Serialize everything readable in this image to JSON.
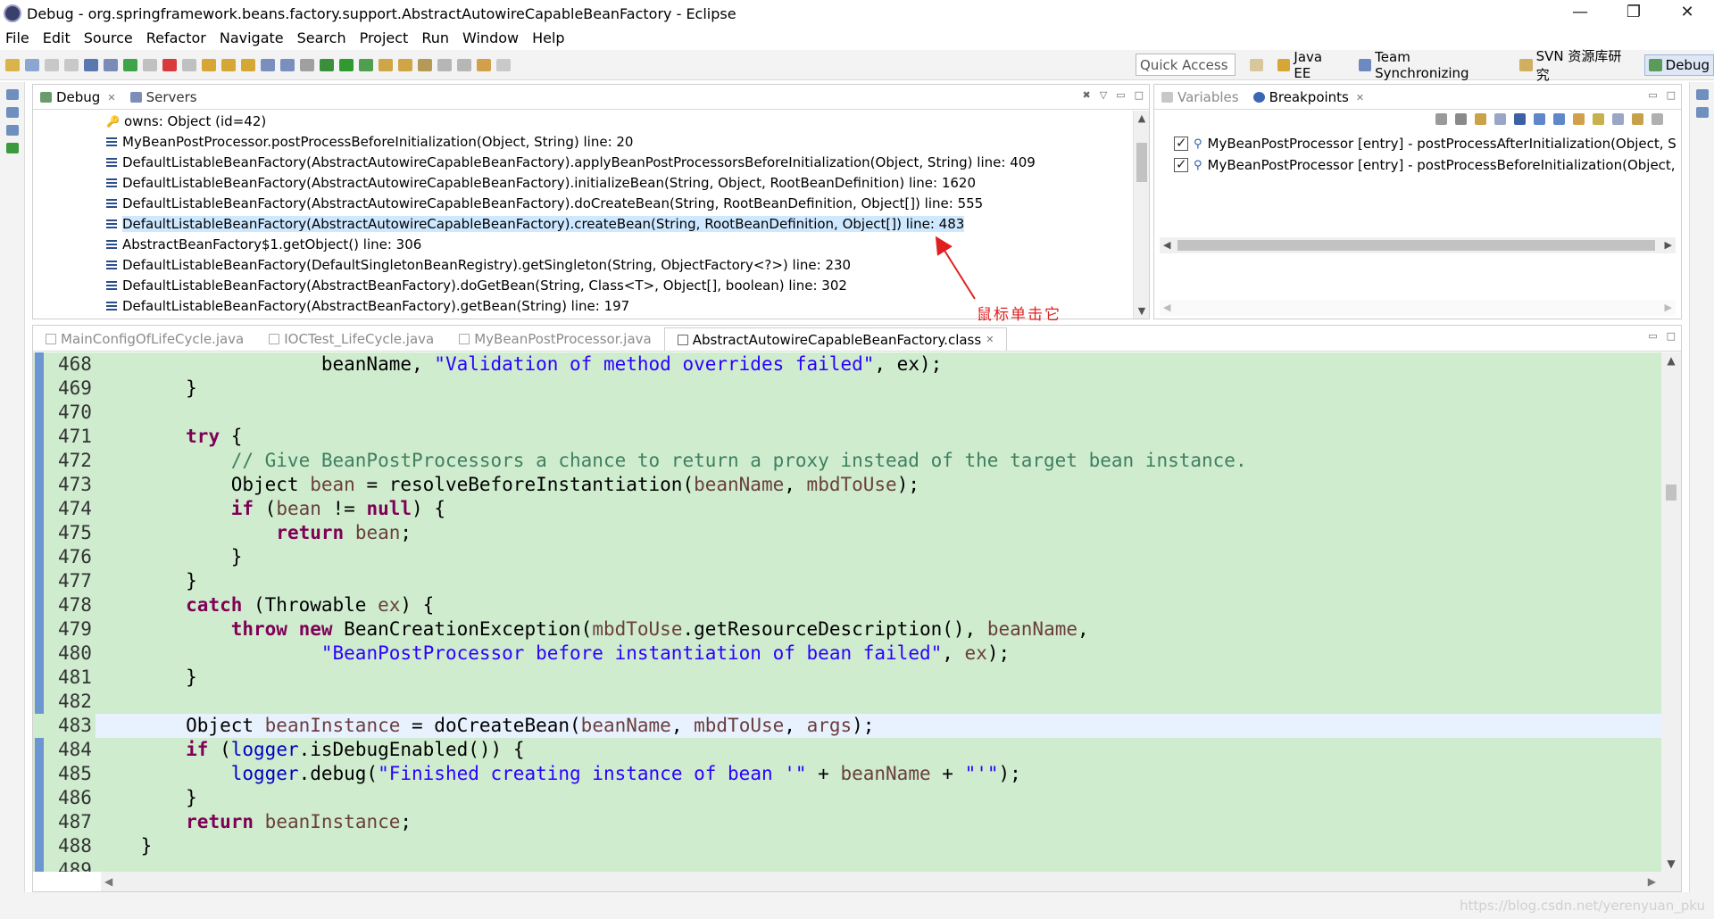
{
  "window": {
    "title": "Debug - org.springframework.beans.factory.support.AbstractAutowireCapableBeanFactory - Eclipse",
    "controls": {
      "minimize": "—",
      "restore": "❐",
      "close": "✕"
    }
  },
  "menu": [
    "File",
    "Edit",
    "Source",
    "Refactor",
    "Navigate",
    "Search",
    "Project",
    "Run",
    "Window",
    "Help"
  ],
  "toolbar": {
    "quick_access": "Quick Access",
    "perspectives": [
      {
        "label": "Java EE",
        "icon": "java-ee-icon",
        "active": false
      },
      {
        "label": "Team Synchronizing",
        "icon": "team-sync-icon",
        "active": false
      },
      {
        "label": "SVN 资源库研究",
        "icon": "svn-icon",
        "active": false
      },
      {
        "label": "Debug",
        "icon": "debug-icon",
        "active": true
      }
    ]
  },
  "debug_view": {
    "tabs": [
      {
        "label": "Debug",
        "active": true,
        "closable": true
      },
      {
        "label": "Servers",
        "active": false,
        "closable": false
      }
    ],
    "stack": [
      {
        "text": "owns: Object  (id=42)",
        "icon": "key-icon",
        "selected": false
      },
      {
        "text": "MyBeanPostProcessor.postProcessBeforeInitialization(Object, String) line: 20",
        "icon": "stack-frame-icon",
        "selected": false
      },
      {
        "text": "DefaultListableBeanFactory(AbstractAutowireCapableBeanFactory).applyBeanPostProcessorsBeforeInitialization(Object, String) line: 409",
        "icon": "stack-frame-icon",
        "selected": false
      },
      {
        "text": "DefaultListableBeanFactory(AbstractAutowireCapableBeanFactory).initializeBean(String, Object, RootBeanDefinition) line: 1620",
        "icon": "stack-frame-icon",
        "selected": false
      },
      {
        "text": "DefaultListableBeanFactory(AbstractAutowireCapableBeanFactory).doCreateBean(String, RootBeanDefinition, Object[]) line: 555",
        "icon": "stack-frame-icon",
        "selected": false
      },
      {
        "text": "DefaultListableBeanFactory(AbstractAutowireCapableBeanFactory).createBean(String, RootBeanDefinition, Object[]) line: 483",
        "icon": "stack-frame-icon",
        "selected": true
      },
      {
        "text": "AbstractBeanFactory$1.getObject() line: 306",
        "icon": "stack-frame-icon",
        "selected": false
      },
      {
        "text": "DefaultListableBeanFactory(DefaultSingletonBeanRegistry).getSingleton(String, ObjectFactory<?>) line: 230",
        "icon": "stack-frame-icon",
        "selected": false
      },
      {
        "text": "DefaultListableBeanFactory(AbstractBeanFactory).doGetBean(String, Class<T>, Object[], boolean) line: 302",
        "icon": "stack-frame-icon",
        "selected": false
      },
      {
        "text": "DefaultListableBeanFactory(AbstractBeanFactory).getBean(String) line: 197",
        "icon": "stack-frame-icon",
        "selected": false
      }
    ]
  },
  "breakpoints_view": {
    "tabs": [
      {
        "label": "Variables",
        "active": false
      },
      {
        "label": "Breakpoints",
        "active": true
      }
    ],
    "items": [
      {
        "text": "MyBeanPostProcessor [entry] - postProcessAfterInitialization(Object, Str",
        "checked": true
      },
      {
        "text": "MyBeanPostProcessor [entry] - postProcessBeforeInitialization(Object, S",
        "checked": true
      }
    ]
  },
  "annotation": {
    "label": "鼠标单击它",
    "color": "#e02020"
  },
  "editor": {
    "tabs": [
      {
        "label": "MainConfigOfLifeCycle.java",
        "active": false
      },
      {
        "label": "IOCTest_LifeCycle.java",
        "active": false
      },
      {
        "label": "MyBeanPostProcessor.java",
        "active": false
      },
      {
        "label": "AbstractAutowireCapableBeanFactory.class",
        "active": true
      }
    ],
    "current_line": 483,
    "lines": [
      {
        "n": "468",
        "tokens": [
          [
            "",
            "                    beanName, "
          ],
          [
            "str",
            "\"Validation of method overrides failed\""
          ],
          [
            "",
            ", ex);"
          ]
        ]
      },
      {
        "n": "469",
        "tokens": [
          [
            "",
            "        }"
          ]
        ]
      },
      {
        "n": "470",
        "tokens": [
          [
            "",
            ""
          ]
        ]
      },
      {
        "n": "471",
        "tokens": [
          [
            "",
            "        "
          ],
          [
            "kw",
            "try"
          ],
          [
            "",
            " {"
          ]
        ]
      },
      {
        "n": "472",
        "tokens": [
          [
            "",
            "            "
          ],
          [
            "cmt",
            "// Give BeanPostProcessors a chance to return a proxy instead of the target bean instance."
          ]
        ]
      },
      {
        "n": "473",
        "tokens": [
          [
            "",
            "            Object "
          ],
          [
            "var",
            "bean"
          ],
          [
            "",
            " = resolveBeforeInstantiation("
          ],
          [
            "var",
            "beanName"
          ],
          [
            "",
            ", "
          ],
          [
            "var",
            "mbdToUse"
          ],
          [
            "",
            ");"
          ]
        ]
      },
      {
        "n": "474",
        "tokens": [
          [
            "",
            "            "
          ],
          [
            "kw",
            "if"
          ],
          [
            "",
            " ("
          ],
          [
            "var",
            "bean"
          ],
          [
            "",
            " != "
          ],
          [
            "kw",
            "null"
          ],
          [
            "",
            ") {"
          ]
        ]
      },
      {
        "n": "475",
        "tokens": [
          [
            "",
            "                "
          ],
          [
            "kw",
            "return"
          ],
          [
            "",
            " "
          ],
          [
            "var",
            "bean"
          ],
          [
            "",
            ";"
          ]
        ]
      },
      {
        "n": "476",
        "tokens": [
          [
            "",
            "            }"
          ]
        ]
      },
      {
        "n": "477",
        "tokens": [
          [
            "",
            "        }"
          ]
        ]
      },
      {
        "n": "478",
        "tokens": [
          [
            "",
            "        "
          ],
          [
            "kw",
            "catch"
          ],
          [
            "",
            " (Throwable "
          ],
          [
            "var",
            "ex"
          ],
          [
            "",
            ") {"
          ]
        ]
      },
      {
        "n": "479",
        "tokens": [
          [
            "",
            "            "
          ],
          [
            "kw",
            "throw"
          ],
          [
            "",
            " "
          ],
          [
            "kw",
            "new"
          ],
          [
            "",
            " BeanCreationException("
          ],
          [
            "var",
            "mbdToUse"
          ],
          [
            "",
            ".getResourceDescription(), "
          ],
          [
            "var",
            "beanName"
          ],
          [
            "",
            ","
          ]
        ]
      },
      {
        "n": "480",
        "tokens": [
          [
            "",
            "                    "
          ],
          [
            "str",
            "\"BeanPostProcessor before instantiation of bean failed\""
          ],
          [
            "",
            ", "
          ],
          [
            "var",
            "ex"
          ],
          [
            "",
            ");"
          ]
        ]
      },
      {
        "n": "481",
        "tokens": [
          [
            "",
            "        }"
          ]
        ]
      },
      {
        "n": "482",
        "tokens": [
          [
            "",
            ""
          ]
        ]
      },
      {
        "n": "483",
        "tokens": [
          [
            "",
            "        Object "
          ],
          [
            "var",
            "beanInstance"
          ],
          [
            "",
            " = doCreateBean("
          ],
          [
            "var",
            "beanName"
          ],
          [
            "",
            ", "
          ],
          [
            "var",
            "mbdToUse"
          ],
          [
            "",
            ", "
          ],
          [
            "var",
            "args"
          ],
          [
            "",
            ");"
          ]
        ]
      },
      {
        "n": "484",
        "tokens": [
          [
            "",
            "        "
          ],
          [
            "kw",
            "if"
          ],
          [
            "",
            " ("
          ],
          [
            "fld",
            "logger"
          ],
          [
            "",
            ".isDebugEnabled()) {"
          ]
        ]
      },
      {
        "n": "485",
        "tokens": [
          [
            "",
            "            "
          ],
          [
            "fld",
            "logger"
          ],
          [
            "",
            ".debug("
          ],
          [
            "str",
            "\"Finished creating instance of bean '\""
          ],
          [
            "",
            " + "
          ],
          [
            "var",
            "beanName"
          ],
          [
            "",
            " + "
          ],
          [
            "str",
            "\"'\""
          ],
          [
            "",
            ");"
          ]
        ]
      },
      {
        "n": "486",
        "tokens": [
          [
            "",
            "        }"
          ]
        ]
      },
      {
        "n": "487",
        "tokens": [
          [
            "",
            "        "
          ],
          [
            "kw",
            "return"
          ],
          [
            "",
            " "
          ],
          [
            "var",
            "beanInstance"
          ],
          [
            "",
            ";"
          ]
        ]
      },
      {
        "n": "488",
        "tokens": [
          [
            "",
            "    }"
          ]
        ]
      },
      {
        "n": "489",
        "tokens": [
          [
            "",
            ""
          ]
        ]
      }
    ]
  },
  "status": {
    "watermark": "https://blog.csdn.net/yerenyuan_pku"
  }
}
